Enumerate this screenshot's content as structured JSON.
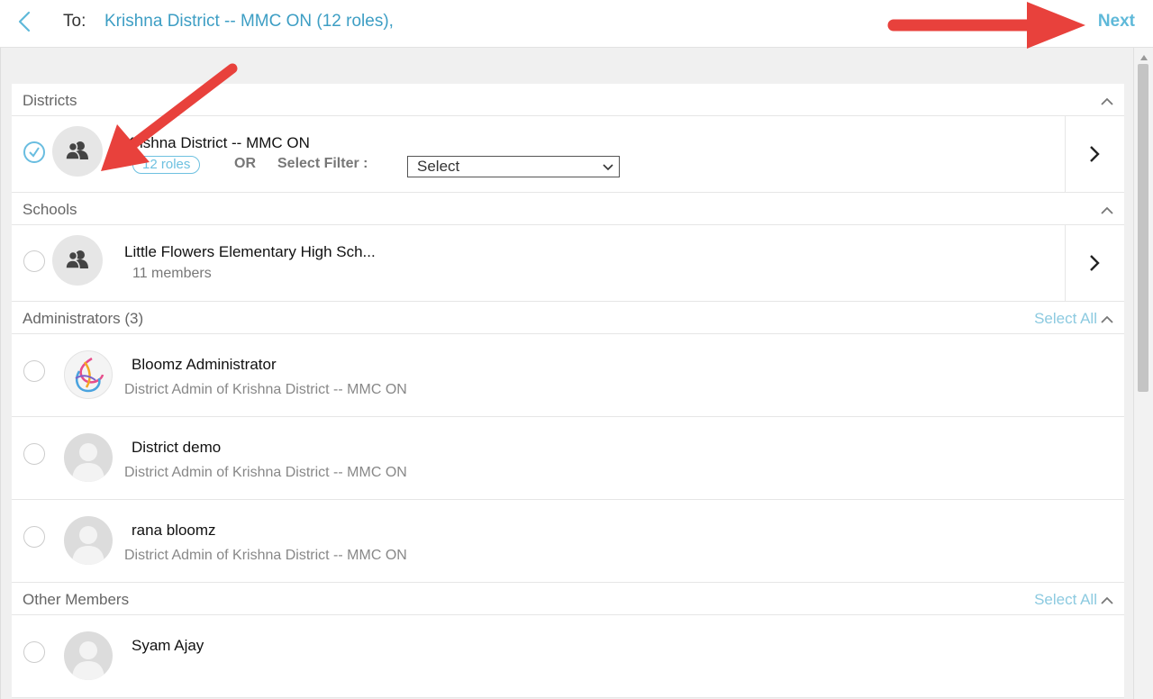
{
  "header": {
    "to_label": "To:",
    "to_value": "Krishna District -- MMC ON (12 roles),",
    "next_label": "Next"
  },
  "sections": {
    "districts": {
      "title": "Districts",
      "item": {
        "name": "Krishna District -- MMC ON",
        "roles": "12 roles",
        "or": "OR",
        "filter_label": "Select Filter :",
        "filter_value": "Select"
      }
    },
    "schools": {
      "title": "Schools",
      "item": {
        "name": "Little Flowers Elementary High Sch...",
        "members": "11 members"
      }
    },
    "administrators": {
      "title": "Administrators (3)",
      "select_all": "Select All",
      "members": [
        {
          "name": "Bloomz Administrator",
          "role": "District Admin of Krishna District -- MMC ON"
        },
        {
          "name": "District demo",
          "role": "District Admin of Krishna District -- MMC ON"
        },
        {
          "name": "rana bloomz",
          "role": "District Admin of Krishna District -- MMC ON"
        }
      ]
    },
    "other_members": {
      "title": "Other Members",
      "select_all": "Select All",
      "members": [
        {
          "name": "Syam Ajay"
        }
      ]
    }
  },
  "colors": {
    "accent": "#3d9ec4",
    "link_light": "#8ccae0",
    "annotation_arrow": "#e8413c"
  }
}
